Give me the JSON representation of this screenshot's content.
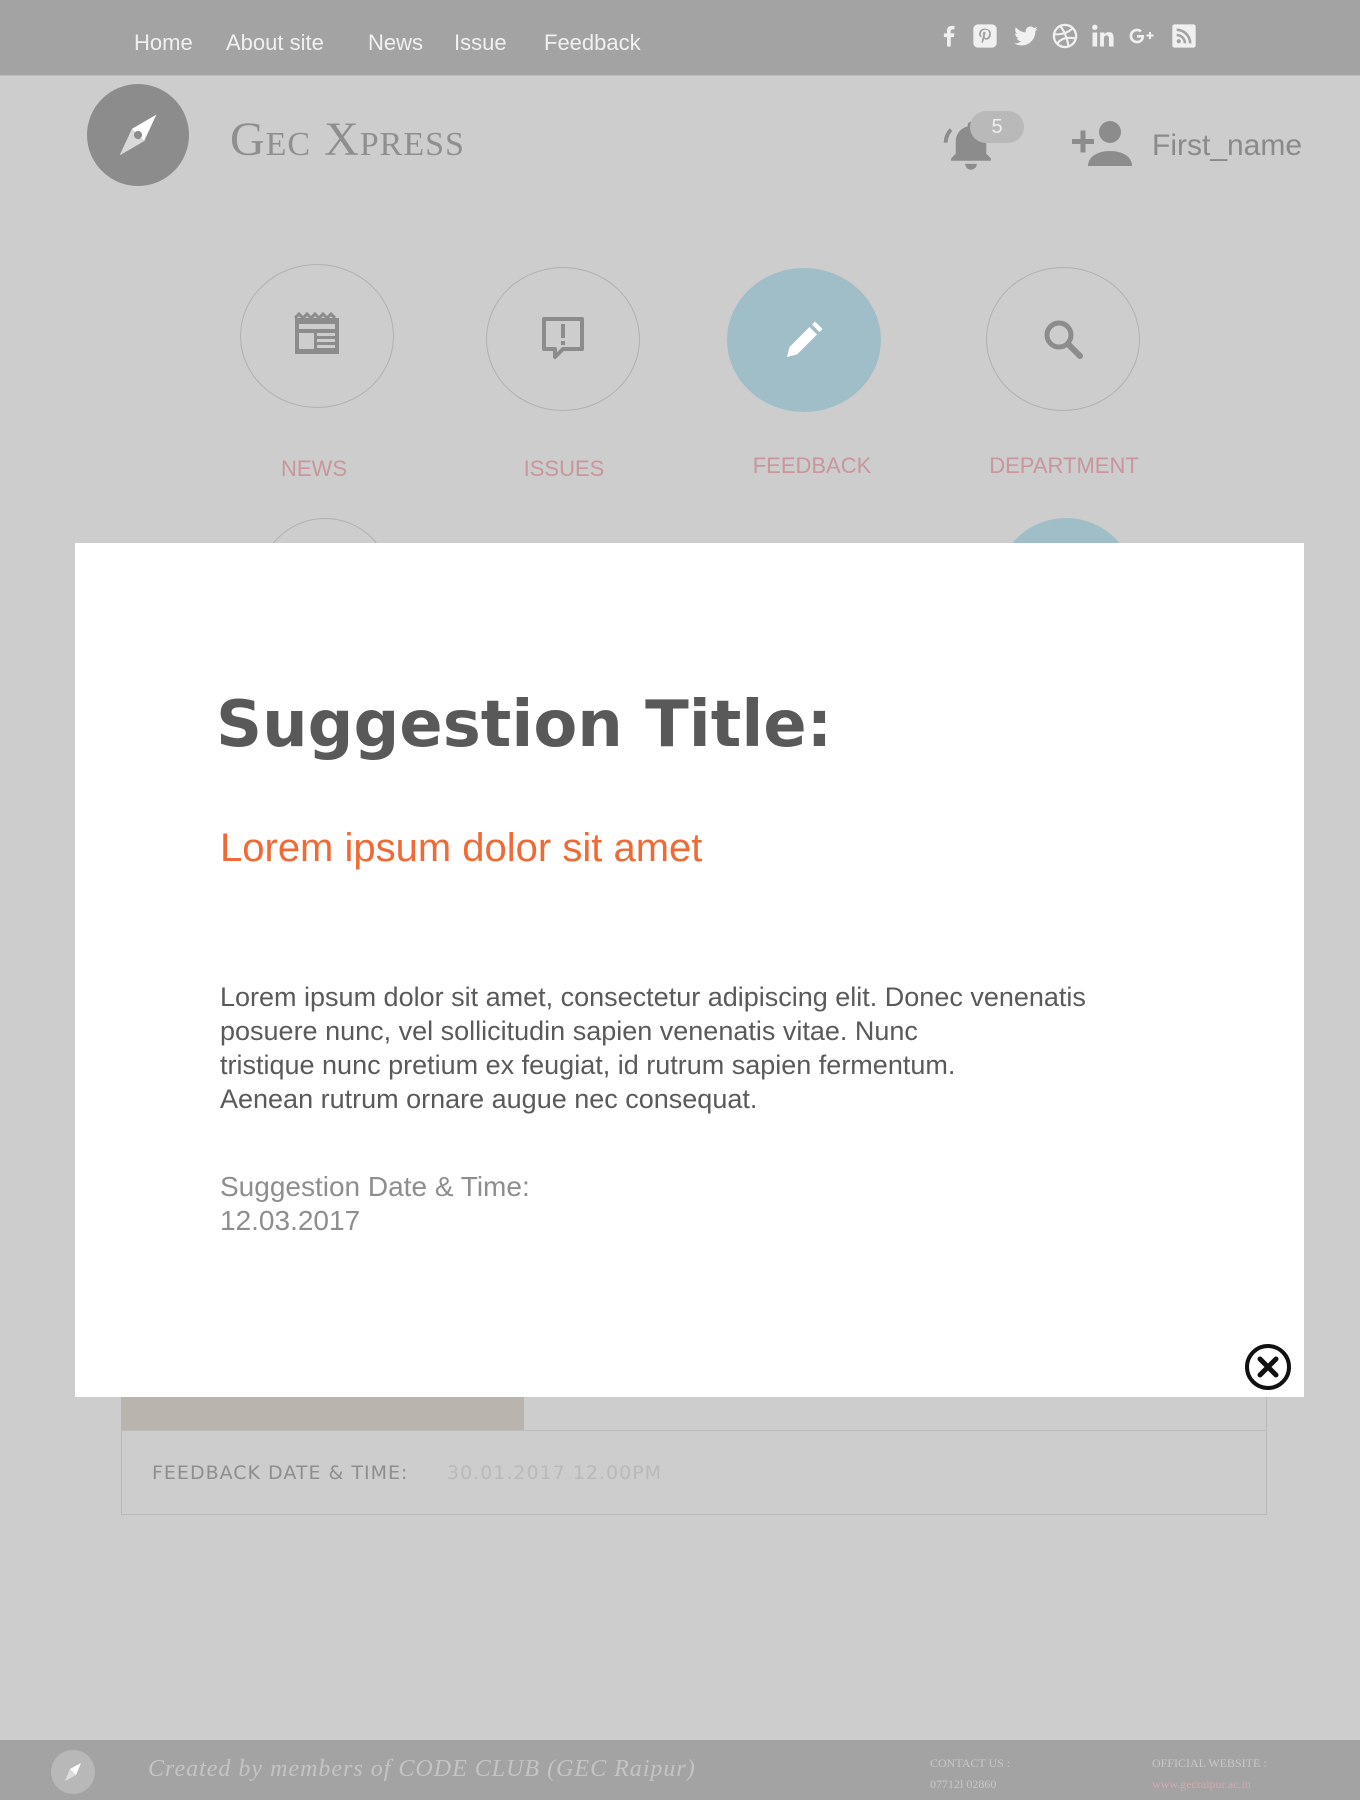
{
  "nav": {
    "links": [
      "Home",
      "About site",
      "News",
      "Issue",
      "Feedback"
    ],
    "social_icons": [
      "facebook-icon",
      "pinterest-icon",
      "twitter-icon",
      "dribbble-icon",
      "linkedin-icon",
      "google-plus-icon",
      "rss-icon"
    ]
  },
  "header": {
    "brand": "Gec Xpress",
    "notification_count": "5",
    "username": "First_name",
    "icons": [
      "compass-icon",
      "bell-icon",
      "add-user-icon"
    ]
  },
  "features": [
    {
      "label": "NEWS",
      "icon": "newspaper-icon"
    },
    {
      "label": "ISSUES",
      "icon": "alert-message-icon"
    },
    {
      "label": "FEEDBACK",
      "icon": "pencil-icon"
    },
    {
      "label": "DEPARTMENT",
      "icon": "search-icon"
    }
  ],
  "background_card": {
    "label": "FEEDBACK DATE & TIME:",
    "value": "30.01.2017  12.00PM"
  },
  "modal": {
    "title": "Suggestion Title:",
    "subtitle": "Lorem ipsum dolor sit amet",
    "body_lines": [
      "Lorem ipsum dolor sit amet, consectetur adipiscing elit. Donec venenatis",
      "posuere nunc, vel sollicitudin sapien venenatis vitae. Nunc",
      "tristique nunc pretium ex feugiat, id rutrum sapien fermentum.",
      "Aenean rutrum ornare augue nec consequat."
    ],
    "date_label": "Suggestion Date & Time:",
    "date_value": "12.03.2017",
    "close_icon": "close-icon"
  },
  "footer": {
    "credit": "Created by members of CODE CLUB (GEC Raipur)",
    "contact_label": "CONTACT US :",
    "contact_value": "07712l 02860",
    "website_label": "OFFICIAL WEBSITE :",
    "website_value": "www.gecraipur.ac.in"
  },
  "colors": {
    "nav_bg": "#a3a3a3",
    "overlay_bg": "#cdcdcd",
    "active_feature": "#9fbec7",
    "feature_label": "#c8969b",
    "modal_subtitle": "#f06a35"
  }
}
